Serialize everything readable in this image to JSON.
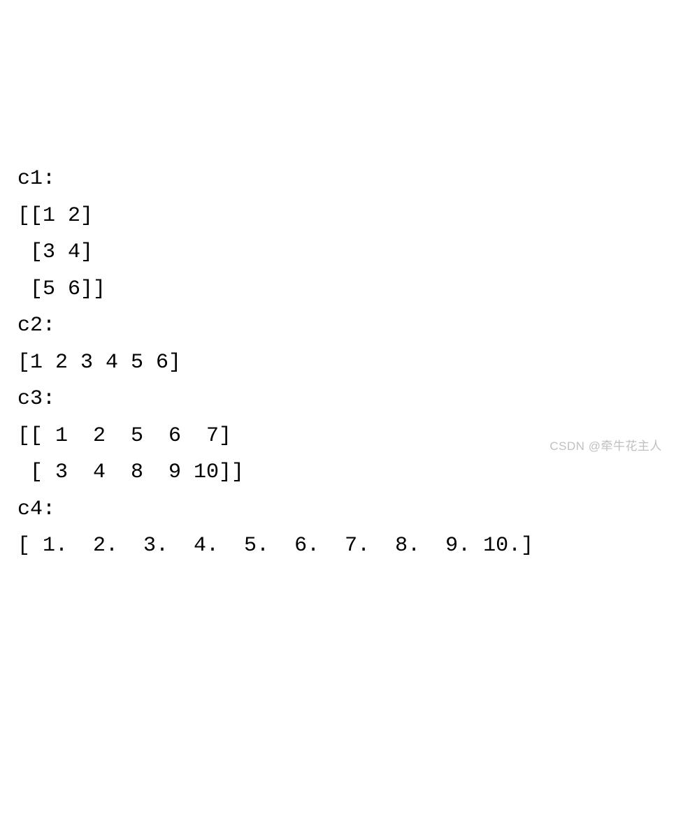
{
  "lines": {
    "l1": "c1:",
    "l2": "[[1 2]",
    "l3": " [3 4]",
    "l4": " [5 6]]",
    "l5": "c2:",
    "l6": "[1 2 3 4 5 6]",
    "l7": "c3:",
    "l8": "[[ 1  2  5  6  7]",
    "l9": " [ 3  4  8  9 10]]",
    "l10": "c4:",
    "l11": "[ 1.  2.  3.  4.  5.  6.  7.  8.  9. 10.]"
  },
  "watermark": "CSDN @牵牛花主人"
}
